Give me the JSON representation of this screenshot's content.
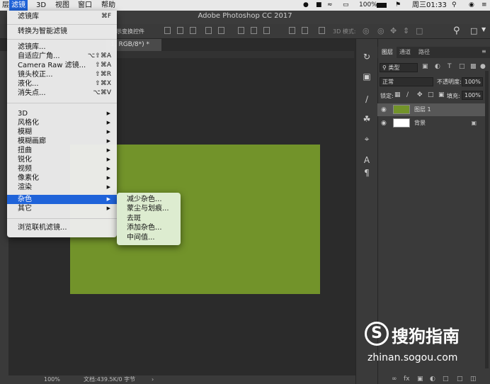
{
  "menubar": {
    "items": [
      {
        "label": "层"
      },
      {
        "label": "滤镜"
      },
      {
        "label": "3D"
      },
      {
        "label": "视图"
      },
      {
        "label": "窗口"
      },
      {
        "label": "帮助"
      }
    ],
    "battery": "100%",
    "clock": "周三01:33"
  },
  "app": {
    "title": "Adobe Photoshop CC 2017",
    "options_label": "示变换控件",
    "mode_label": "3D 模式:"
  },
  "document": {
    "tab_label": "1, RGB/8*) *",
    "zoom": "100%",
    "doc_size": "文档:439.5K/0 字节",
    "canvas_color": "#72932a"
  },
  "filter_menu": {
    "top": [
      {
        "label": "滤镜库",
        "shortcut": "⌘F"
      }
    ],
    "smart": {
      "label": "转换为智能滤镜"
    },
    "group1": [
      {
        "label": "滤镜库...",
        "shortcut": ""
      },
      {
        "label": "自适应广角...",
        "shortcut": "⌥⇧⌘A"
      },
      {
        "label": "Camera Raw 滤镜...",
        "shortcut": "⇧⌘A"
      },
      {
        "label": "镜头校正...",
        "shortcut": "⇧⌘R"
      },
      {
        "label": "液化...",
        "shortcut": "⇧⌘X"
      },
      {
        "label": "消失点...",
        "shortcut": "⌥⌘V"
      }
    ],
    "group2": [
      {
        "label": "3D"
      },
      {
        "label": "风格化"
      },
      {
        "label": "模糊"
      },
      {
        "label": "模糊画廊"
      },
      {
        "label": "扭曲"
      },
      {
        "label": "锐化"
      },
      {
        "label": "视频"
      },
      {
        "label": "像素化"
      },
      {
        "label": "渲染"
      },
      {
        "label": "杂色"
      },
      {
        "label": "其它"
      }
    ],
    "browse": {
      "label": "浏览联机滤镜..."
    }
  },
  "noise_submenu": [
    {
      "label": "减少杂色..."
    },
    {
      "label": "蒙尘与划痕..."
    },
    {
      "label": "去斑"
    },
    {
      "label": "添加杂色..."
    },
    {
      "label": "中间值..."
    }
  ],
  "layers_panel": {
    "tabs": [
      {
        "label": "图层"
      },
      {
        "label": "通道"
      },
      {
        "label": "路径"
      }
    ],
    "kind_filter": "类型",
    "blend_mode": "正常",
    "opacity_label": "不透明度:",
    "opacity_value": "100%",
    "lock_label": "锁定:",
    "fill_label": "填充:",
    "fill_value": "100%",
    "layers": [
      {
        "name": "图层 1",
        "thumb_color": "#72932a"
      },
      {
        "name": "背景",
        "thumb_color": "#ffffff"
      }
    ]
  },
  "watermark": {
    "logo_letter": "S",
    "brand": "搜狗指南",
    "url": "zhinan.sogou.com"
  }
}
